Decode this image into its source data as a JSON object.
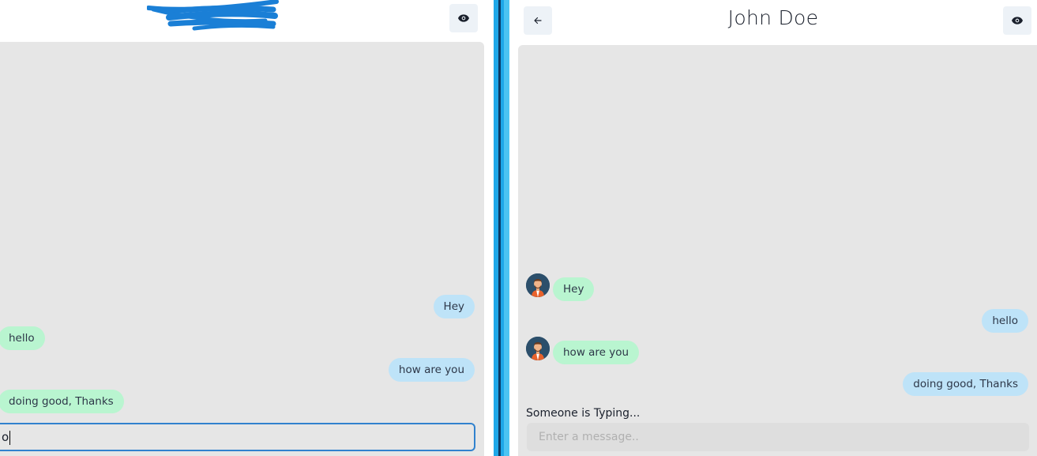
{
  "left": {
    "eye_icon": "eye-icon",
    "messages": [
      {
        "text": "Hey",
        "side": "mine"
      },
      {
        "text": "hello",
        "side": "theirs"
      },
      {
        "text": "how are you",
        "side": "mine"
      },
      {
        "text": "doing good, Thanks",
        "side": "theirs"
      }
    ],
    "input_value": "o"
  },
  "right": {
    "title": "John Doe",
    "back_icon": "arrow-left-icon",
    "eye_icon": "eye-icon",
    "messages": [
      {
        "text": "Hey",
        "side": "theirs"
      },
      {
        "text": "hello",
        "side": "mine"
      },
      {
        "text": "how are you",
        "side": "theirs"
      },
      {
        "text": "doing good, Thanks",
        "side": "mine"
      }
    ],
    "typing_text": "Someone is Typing...",
    "input_placeholder": "Enter a message.."
  },
  "colors": {
    "mine_bubble": "#bee3f8",
    "theirs_bubble": "#b9f5d0",
    "chat_bg": "#e6e6e6",
    "focus_border": "#3182ce",
    "divider": "#1ea7e8"
  }
}
